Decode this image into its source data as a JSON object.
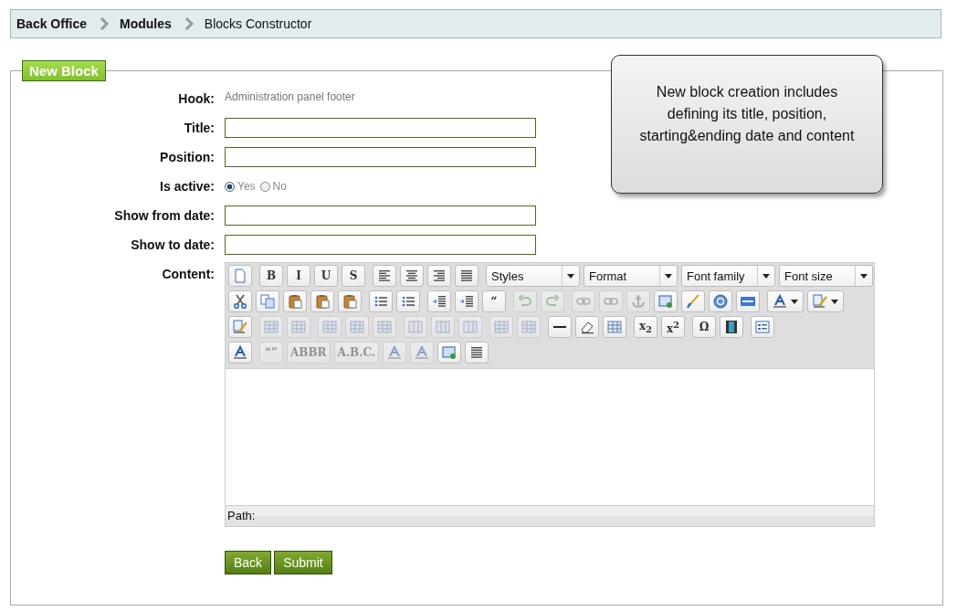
{
  "breadcrumb": [
    {
      "text": "Back Office",
      "kind": "link"
    },
    {
      "text": "Modules",
      "kind": "link"
    },
    {
      "text": "Blocks Constructor",
      "kind": "current"
    }
  ],
  "legend": "New Block",
  "fields": [
    {
      "kind": "static",
      "label": "Hook:",
      "value": "Administration panel footer"
    },
    {
      "kind": "text",
      "label": "Title:"
    },
    {
      "kind": "text",
      "label": "Position:"
    },
    {
      "kind": "radio",
      "label": "Is active:",
      "options": [
        {
          "label": "Yes",
          "selected": true
        },
        {
          "label": "No",
          "selected": false
        }
      ]
    },
    {
      "kind": "text",
      "label": "Show from date:"
    },
    {
      "kind": "text",
      "label": "Show to date:"
    }
  ],
  "editor": {
    "label": "Content:",
    "status_label": "Path:",
    "toolbar": {
      "rows": [
        {
          "groups": [
            {
              "items": [
                {
                  "kind": "icon",
                  "disabled": false
                }
              ]
            },
            {
              "items": [
                {
                  "kind": "glyph",
                  "text": "B",
                  "disabled": false
                },
                {
                  "kind": "glyph",
                  "text": "I",
                  "disabled": false
                },
                {
                  "kind": "glyph",
                  "text": "U",
                  "disabled": false
                },
                {
                  "kind": "glyph",
                  "text": "S",
                  "disabled": false
                }
              ]
            },
            {
              "items": [
                {
                  "kind": "icon",
                  "disabled": false
                },
                {
                  "kind": "icon",
                  "disabled": false
                },
                {
                  "kind": "icon",
                  "disabled": false
                },
                {
                  "kind": "icon",
                  "disabled": false
                }
              ]
            },
            {
              "items": [
                {
                  "kind": "select",
                  "label": "Styles"
                },
                {
                  "kind": "select",
                  "label": "Format"
                },
                {
                  "kind": "select",
                  "label": "Font family"
                },
                {
                  "kind": "select",
                  "label": "Font size"
                }
              ]
            }
          ]
        },
        {
          "groups": [
            {
              "items": [
                {
                  "kind": "icon",
                  "disabled": false
                },
                {
                  "kind": "icon",
                  "disabled": false
                },
                {
                  "kind": "icon",
                  "disabled": false
                },
                {
                  "kind": "icon",
                  "disabled": false
                },
                {
                  "kind": "icon",
                  "disabled": false
                }
              ]
            },
            {
              "items": [
                {
                  "kind": "icon",
                  "disabled": false
                },
                {
                  "kind": "icon",
                  "disabled": false
                }
              ]
            },
            {
              "items": [
                {
                  "kind": "icon",
                  "disabled": false
                },
                {
                  "kind": "icon",
                  "disabled": false
                },
                {
                  "kind": "glyph",
                  "text": "“",
                  "disabled": false
                }
              ]
            },
            {
              "items": [
                {
                  "kind": "icon",
                  "disabled": true
                },
                {
                  "kind": "icon",
                  "disabled": true
                }
              ]
            },
            {
              "items": [
                {
                  "kind": "icon",
                  "disabled": true
                },
                {
                  "kind": "icon",
                  "disabled": true
                },
                {
                  "kind": "icon",
                  "disabled": true
                },
                {
                  "kind": "icon",
                  "disabled": false
                },
                {
                  "kind": "icon",
                  "disabled": false
                },
                {
                  "kind": "icon",
                  "disabled": false
                },
                {
                  "kind": "icon",
                  "disabled": false
                }
              ]
            },
            {
              "items": [
                {
                  "kind": "split",
                  "disabled": false
                },
                {
                  "kind": "split",
                  "disabled": false
                }
              ]
            }
          ]
        },
        {
          "groups": [
            {
              "items": [
                {
                  "kind": "icon",
                  "disabled": false
                }
              ]
            },
            {
              "items": [
                {
                  "kind": "icon",
                  "disabled": true
                },
                {
                  "kind": "icon",
                  "disabled": true
                }
              ]
            },
            {
              "items": [
                {
                  "kind": "icon",
                  "disabled": true
                },
                {
                  "kind": "icon",
                  "disabled": true
                },
                {
                  "kind": "icon",
                  "disabled": true
                }
              ]
            },
            {
              "items": [
                {
                  "kind": "icon",
                  "disabled": true
                },
                {
                  "kind": "icon",
                  "disabled": true
                },
                {
                  "kind": "icon",
                  "disabled": true
                }
              ]
            },
            {
              "items": [
                {
                  "kind": "icon",
                  "disabled": true
                },
                {
                  "kind": "icon",
                  "disabled": true
                }
              ]
            },
            {
              "items": [
                {
                  "kind": "icon",
                  "disabled": false
                },
                {
                  "kind": "icon",
                  "disabled": false
                },
                {
                  "kind": "icon",
                  "disabled": false
                }
              ]
            },
            {
              "items": [
                {
                  "kind": "glyph",
                  "text": "x$_{2}$",
                  "disabled": false
                },
                {
                  "kind": "glyph",
                  "text": "x$^{2}$",
                  "disabled": false
                }
              ]
            },
            {
              "items": [
                {
                  "kind": "glyph",
                  "text": "Ω",
                  "disabled": false
                },
                {
                  "kind": "icon",
                  "disabled": false
                }
              ]
            },
            {
              "items": [
                {
                  "kind": "icon",
                  "disabled": false
                }
              ]
            }
          ]
        },
        {
          "groups": [
            {
              "items": [
                {
                  "kind": "icon",
                  "disabled": false
                }
              ]
            },
            {
              "items": [
                {
                  "kind": "glyph",
                  "text": "“”",
                  "disabled": true
                },
                {
                  "kind": "glyph",
                  "text": "ABBR",
                  "disabled": true
                },
                {
                  "kind": "glyph",
                  "text": "A.B.C.",
                  "disabled": true
                },
                {
                  "kind": "icon",
                  "disabled": true
                },
                {
                  "kind": "icon",
                  "disabled": true
                },
                {
                  "kind": "icon",
                  "disabled": false
                },
                {
                  "kind": "icon",
                  "disabled": false
                }
              ]
            }
          ]
        }
      ]
    }
  },
  "buttons": [
    "Back",
    "Submit"
  ],
  "callout": "New block creation includes defining its title, position, starting&ending date and content"
}
